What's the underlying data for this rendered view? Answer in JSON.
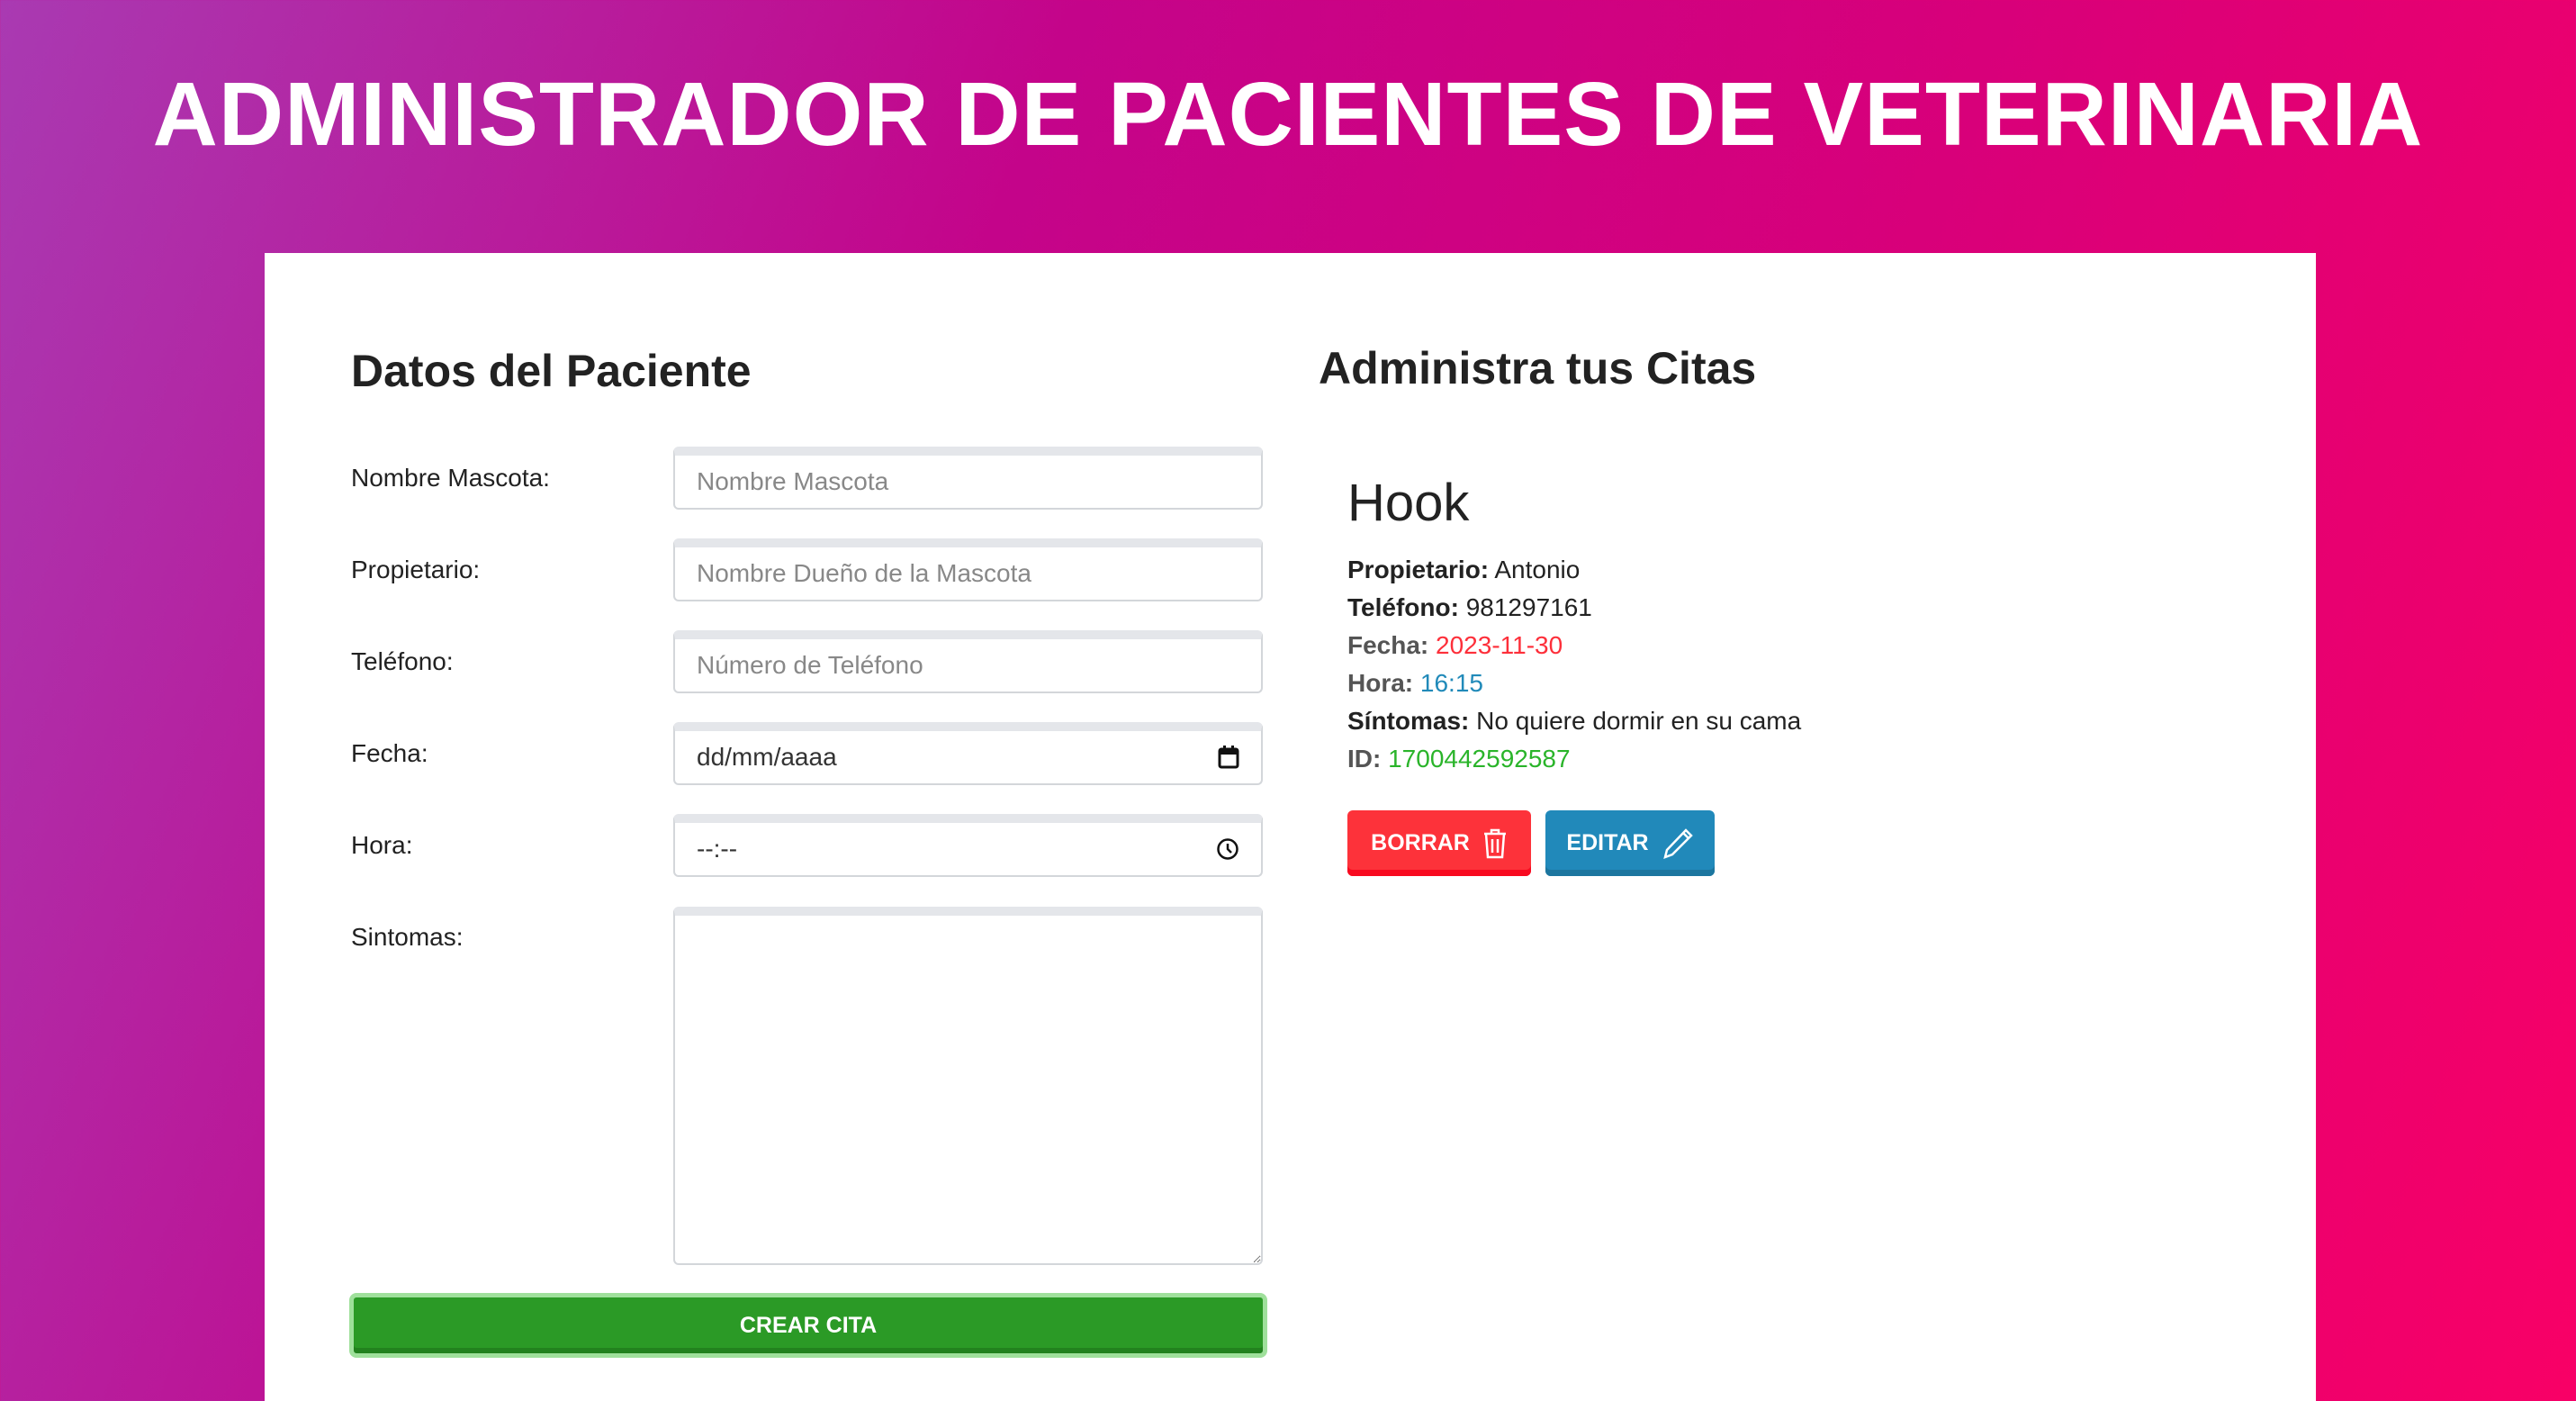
{
  "header": {
    "title": "ADMINISTRADOR DE PACIENTES DE VETERINARIA"
  },
  "form": {
    "heading": "Datos del Paciente",
    "fields": [
      {
        "label": "Nombre Mascota:",
        "placeholder": "Nombre Mascota"
      },
      {
        "label": "Propietario:",
        "placeholder": "Nombre Dueño de la Mascota"
      },
      {
        "label": "Teléfono:",
        "placeholder": "Número de Teléfono"
      },
      {
        "label": "Fecha:",
        "placeholder": "dd/mm/aaaa",
        "icon": "calendar-icon"
      },
      {
        "label": "Hora:",
        "placeholder": "--:--",
        "icon": "clock-icon"
      },
      {
        "label": "Sintomas:"
      }
    ],
    "submit_label": "CREAR CITA"
  },
  "appointments": {
    "heading": "Administra tus Citas",
    "items": [
      {
        "name": "Hook",
        "owner_label": "Propietario:",
        "owner": "Antonio",
        "phone_label": "Teléfono:",
        "phone": "981297161",
        "date_label": "Fecha:",
        "date": "2023-11-30",
        "time_label": "Hora:",
        "time": "16:15",
        "symptoms_label": "Síntomas:",
        "symptoms": "No quiere dormir en su cama",
        "id_label": "ID:",
        "id": "1700442592587",
        "delete_label": "BORRAR",
        "edit_label": "EDITAR"
      }
    ]
  },
  "colors": {
    "date": "#fd2f3a",
    "time": "#218ab9",
    "id": "#2ab42a",
    "delete": "#fd323a",
    "edit": "#2189ba",
    "submit": "#2b9a26"
  }
}
